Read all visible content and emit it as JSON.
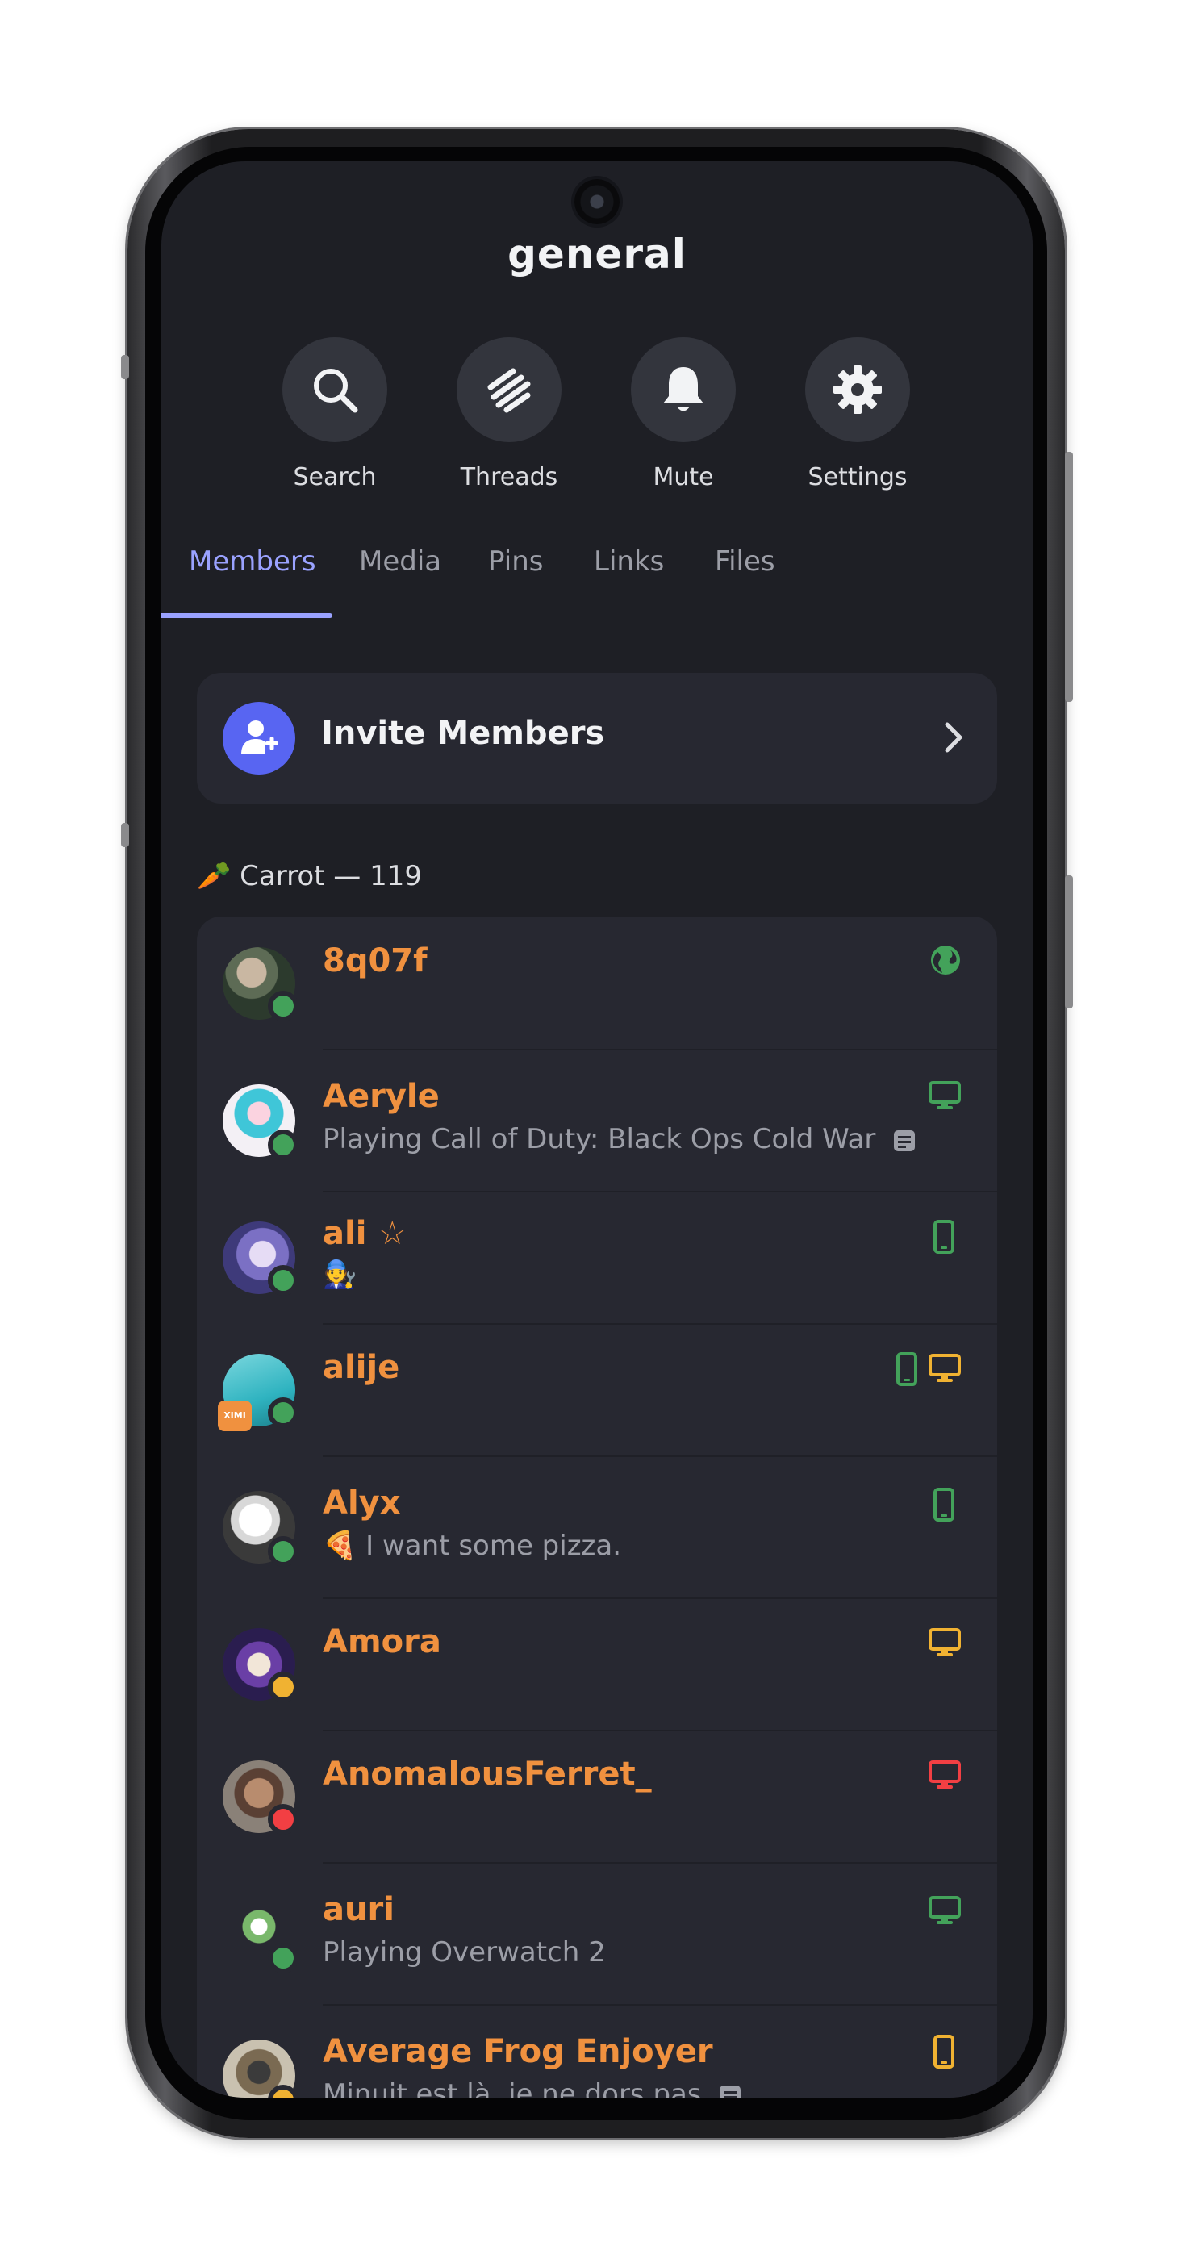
{
  "channel": {
    "title": "general"
  },
  "actions": [
    {
      "label": "Search",
      "icon": "search-icon"
    },
    {
      "label": "Threads",
      "icon": "threads-icon"
    },
    {
      "label": "Mute",
      "icon": "bell-icon"
    },
    {
      "label": "Settings",
      "icon": "gear-icon"
    }
  ],
  "tabs": [
    {
      "label": "Members",
      "active": true
    },
    {
      "label": "Media"
    },
    {
      "label": "Pins"
    },
    {
      "label": "Links"
    },
    {
      "label": "Files"
    }
  ],
  "invite": {
    "label": "Invite Members"
  },
  "section": {
    "emoji": "🥕",
    "label": "Carrot — 119"
  },
  "members": [
    {
      "name": "8q07f",
      "status": "online",
      "platforms": [
        "web"
      ],
      "platform_color": "#43a25a"
    },
    {
      "name": "Aeryle",
      "activity": "Playing Call of Duty: Black Ops Cold War",
      "status": "online",
      "platforms": [
        "desktop"
      ],
      "platform_color": "#43a25a"
    },
    {
      "name": "ali ☆",
      "activity_emoji": "🧑‍🔧",
      "status": "online",
      "platforms": [
        "mobile"
      ],
      "platform_color": "#43a25a"
    },
    {
      "name": "alije",
      "status": "online",
      "platforms": [
        "mobile",
        "desktop"
      ],
      "platform_colors": [
        "#43a25a",
        "#f0b232"
      ],
      "badge": "XIMI"
    },
    {
      "name": "Alyx",
      "activity_emoji": "🍕",
      "activity": "I want some pizza.",
      "status": "online",
      "platforms": [
        "mobile"
      ],
      "platform_color": "#43a25a"
    },
    {
      "name": "Amora",
      "status": "idle",
      "platforms": [
        "desktop"
      ],
      "platform_color": "#f0b232"
    },
    {
      "name": "AnomalousFerret_",
      "status": "dnd",
      "platforms": [
        "desktop"
      ],
      "platform_color": "#f23f43"
    },
    {
      "name": "auri",
      "activity": "Playing Overwatch 2",
      "status": "online",
      "platforms": [
        "desktop"
      ],
      "platform_color": "#43a25a"
    },
    {
      "name": "Average Frog Enjoyer",
      "activity": "Minuit est là, je ne dors pas",
      "status": "idle",
      "platforms": [
        "mobile"
      ],
      "platform_color": "#f0b232"
    }
  ],
  "colors": {
    "background": "#1e1f25",
    "card": "#272831",
    "accent": "#9aa2ff",
    "blurple": "#5865f2",
    "name_orange": "#f0913f",
    "online": "#43a25a",
    "idle": "#f0b232",
    "dnd": "#f23f43"
  }
}
